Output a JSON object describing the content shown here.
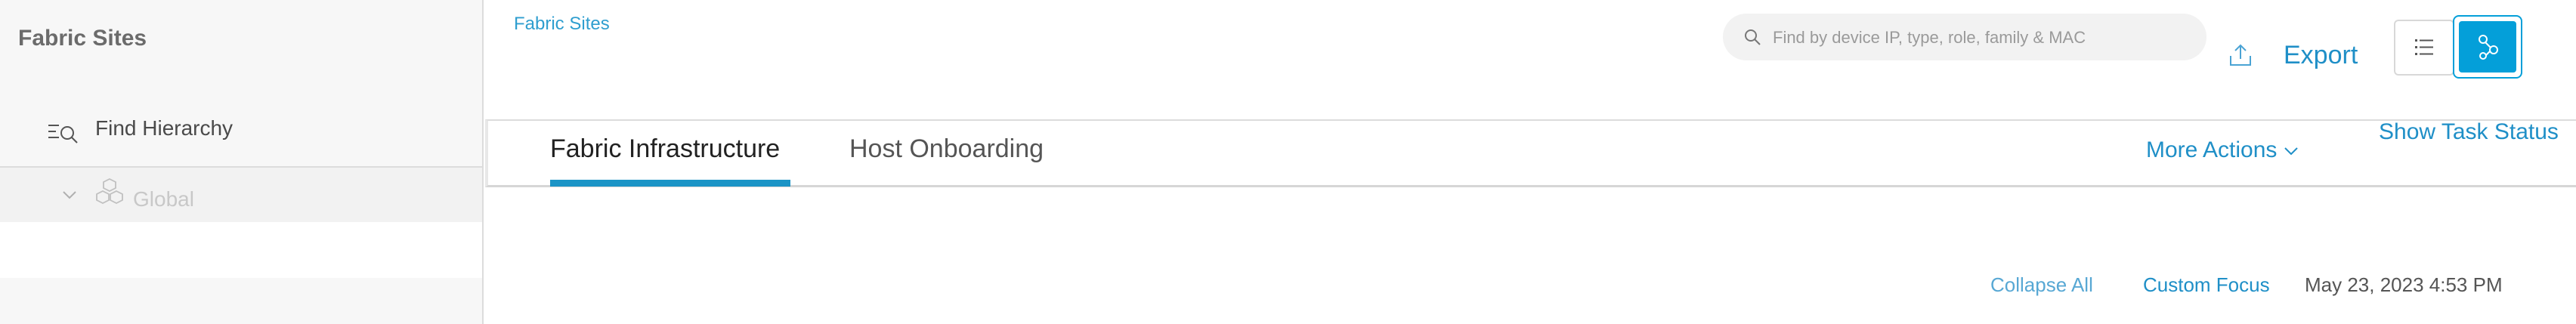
{
  "sidebar": {
    "title": "Fabric Sites",
    "find_hierarchy": "Find Hierarchy",
    "tree": [
      {
        "label": "Global",
        "expanded": true
      }
    ]
  },
  "header": {
    "breadcrumb": "Fabric Sites",
    "search_placeholder": "Find by device IP, type, role, family & MAC",
    "export_label": "Export"
  },
  "tabs": [
    {
      "label": "Fabric Infrastructure",
      "active": true
    },
    {
      "label": "Host Onboarding",
      "active": false
    }
  ],
  "actions": {
    "more_actions": "More Actions",
    "show_task_status": "Show Task Status"
  },
  "toolbar2": {
    "collapse_all": "Collapse All",
    "custom_focus": "Custom Focus",
    "timestamp": "May 23, 2023 4:53 PM"
  },
  "colors": {
    "accent": "#049fd9",
    "link": "#1f8fc7",
    "sidebar_bg": "#f7f7f7"
  }
}
